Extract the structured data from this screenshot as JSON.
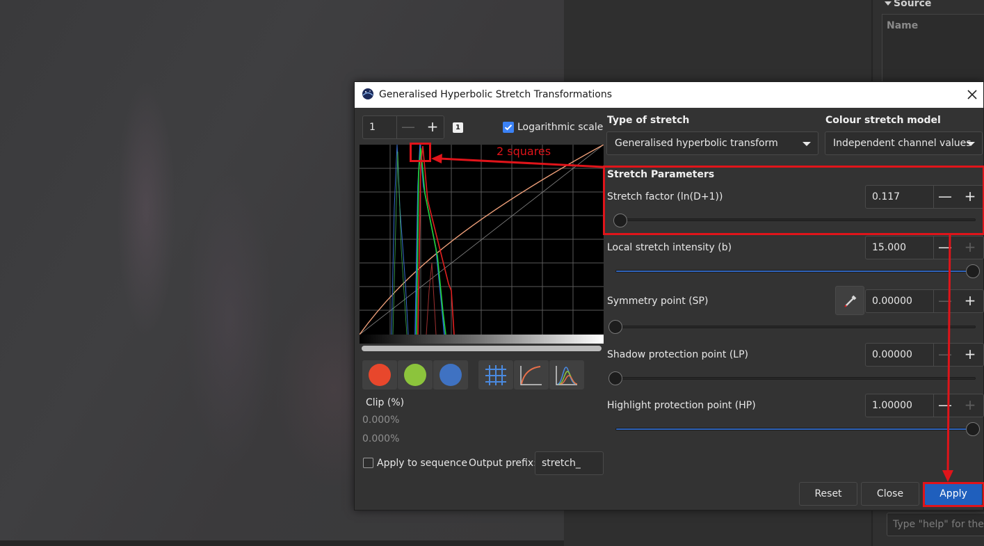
{
  "dialog": {
    "title": "Generalised Hyperbolic Stretch Transformations"
  },
  "histogram_controls": {
    "zoom_value": "1",
    "zoom_badge": "1",
    "log_scale_label": "Logarithmic scale",
    "log_scale_checked": true
  },
  "annotation": {
    "text": "2 squares"
  },
  "channels": [
    {
      "name": "red",
      "color": "#e8472c"
    },
    {
      "name": "green",
      "color": "#8cc43c"
    },
    {
      "name": "blue",
      "color": "#3f72c2"
    }
  ],
  "clip": {
    "label": "Clip (%)",
    "low": "0.000%",
    "high": "0.000%"
  },
  "sequence": {
    "apply_label": "Apply to sequence",
    "prefix_label": "Output prefix:",
    "prefix_value": "stretch_"
  },
  "stretch_type": {
    "label": "Type of stretch",
    "value": "Generalised hyperbolic transform"
  },
  "colour_model": {
    "label": "Colour stretch model",
    "value": "Independent channel values"
  },
  "params": {
    "section_title": "Stretch Parameters",
    "stretch_factor": {
      "label": "Stretch factor (ln(D+1))",
      "value": "0.117",
      "level": 0.0
    },
    "local_intensity": {
      "label": "Local stretch intensity (b)",
      "value": "15.000",
      "level": 1.0
    },
    "symmetry_point": {
      "label": "Symmetry point (SP)",
      "value": "0.00000",
      "level": 0.0
    },
    "shadow_protection": {
      "label": "Shadow protection point (LP)",
      "value": "0.00000",
      "level": 0.0
    },
    "highlight_protection": {
      "label": "Highlight protection point (HP)",
      "value": "1.00000",
      "level": 1.0
    }
  },
  "buttons": {
    "reset": "Reset",
    "close": "Close",
    "apply": "Apply"
  },
  "side_panel": {
    "source_header": "Source",
    "name_column": "Name",
    "help_placeholder": "Type \"help\" for the list of commands"
  },
  "colors": {
    "accent": "#1f5fbd",
    "annotation_red": "#e0141a"
  }
}
